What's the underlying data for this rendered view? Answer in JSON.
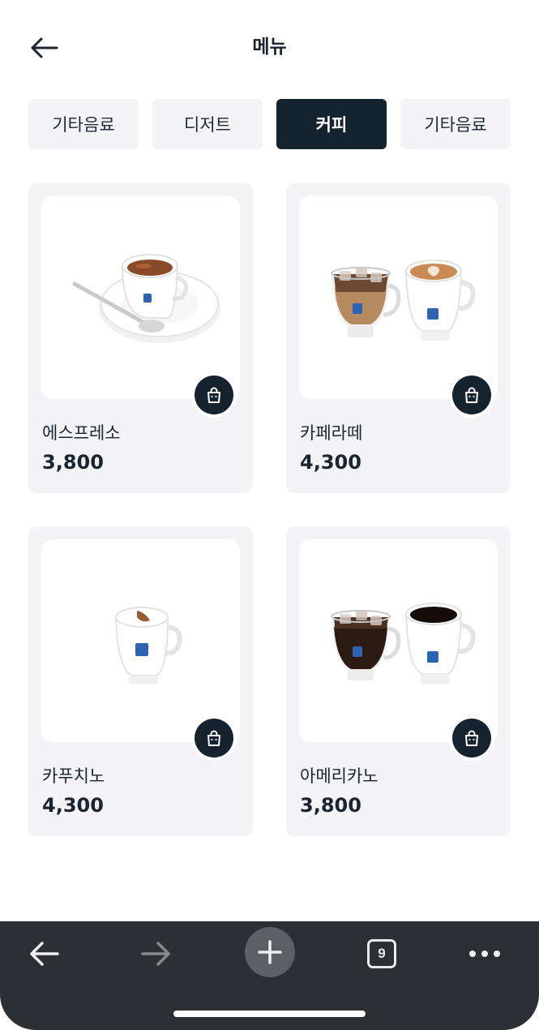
{
  "header": {
    "title": "메뉴"
  },
  "tabs": [
    {
      "label": "기타음료",
      "active": false
    },
    {
      "label": "디저트",
      "active": false
    },
    {
      "label": "커피",
      "active": true
    },
    {
      "label": "기타음료",
      "active": false
    }
  ],
  "products": [
    {
      "name": "에스프레소",
      "price": "3,800",
      "image": "espresso-cup-image"
    },
    {
      "name": "카페라떼",
      "price": "4,300",
      "image": "cafe-latte-cups-image"
    },
    {
      "name": "카푸치노",
      "price": "4,300",
      "image": "cappuccino-cup-image"
    },
    {
      "name": "아메리카노",
      "price": "3,800",
      "image": "americano-cups-image"
    }
  ],
  "browser_toolbar": {
    "tab_count": "9"
  },
  "colors": {
    "accent": "#15222f",
    "card_bg": "#f4f4f6",
    "toolbar_bg": "#2b3034"
  }
}
